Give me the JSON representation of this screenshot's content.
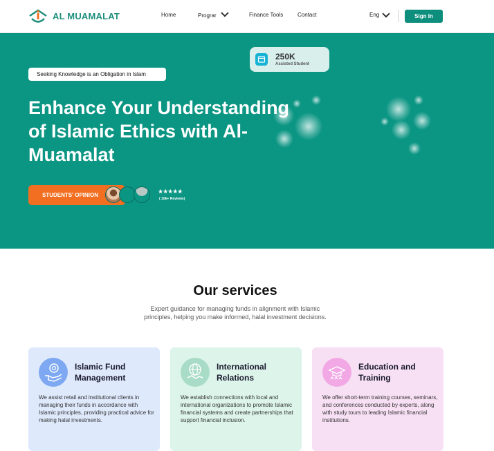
{
  "header": {
    "brand": "AL MUAMALAT",
    "nav": [
      {
        "label": "Home"
      },
      {
        "label": "Prograr"
      },
      {
        "label": "Finance Tools"
      },
      {
        "label": "Contact"
      }
    ],
    "language": "Eng",
    "sign_in": "Sign In"
  },
  "hero": {
    "tagline": "Seeking Knowledge is an Obligation in Islam",
    "title": "Enhance Your Understanding of Islamic Ethics with Al-Muamalat",
    "stat_value": "250K",
    "stat_label": "Assisted Student",
    "cta": "STUDENTS' OPINION",
    "stars": "★★★★★",
    "reviews": "( 10k+ Reviews)"
  },
  "services": {
    "title": "Our services",
    "subtitle": "Expert guidance for managing funds in alignment with Islamic principles, helping you make informed, halal investment decisions.",
    "cards": [
      {
        "title": "Islamic Fund Management",
        "text": "We assist retail and institutional clients in managing their funds in accordance with Islamic principles, providing practical advice for making halal investments.",
        "icon": "hand-coin-icon",
        "bg": "#dfe9fc",
        "icon_bg": "#7ea9f2"
      },
      {
        "title": "International Relations",
        "text": "We establish connections with local and international organizations to promote Islamic financial systems and create partnerships that support financial inclusion.",
        "icon": "globe-handshake-icon",
        "bg": "#dcf4ea",
        "icon_bg": "#a9dcc6"
      },
      {
        "title": "Education and Training",
        "text": "We offer short-term training courses, seminars, and conferences conducted by experts, along with study tours to leading Islamic financial institutions.",
        "icon": "graduation-cap-icon",
        "bg": "#f8e0f4",
        "icon_bg": "#f2a8e4"
      }
    ]
  },
  "colors": {
    "primary": "#0b9583",
    "accent": "#f26f21",
    "brand_text": "#1e8f7d"
  }
}
